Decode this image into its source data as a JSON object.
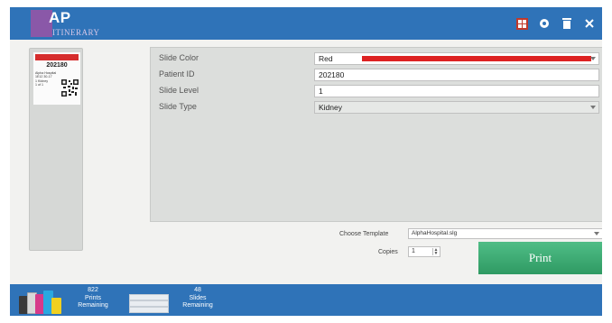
{
  "header": {
    "logo_text": "AP",
    "logo_sub": "ITINERARY",
    "icons": [
      "cassette-icon",
      "gear-icon",
      "trash-icon",
      "close-icon"
    ]
  },
  "preview": {
    "slide_id": "202180",
    "label_lines": [
      "Alpha Hospital",
      "1E12 30-17",
      "1 Kidney",
      "1 of 1"
    ]
  },
  "form": {
    "fields": [
      {
        "label": "Slide Color",
        "value": "Red"
      },
      {
        "label": "Patient ID",
        "value": "202180"
      },
      {
        "label": "Slide Level",
        "value": "1"
      },
      {
        "label": "Slide Type",
        "value": "Kidney"
      }
    ],
    "color_swatch": "#dd2222"
  },
  "controls": {
    "template_label": "Choose Template",
    "template_value": "AlphaHospital.slg",
    "copies_label": "Copies",
    "copies_value": "1",
    "print_label": "Print"
  },
  "footer": {
    "prints_count": "822",
    "prints_label1": "Prints",
    "prints_label2": "Remaining",
    "slides_count": "48",
    "slides_label1": "Slides",
    "slides_label2": "Remaining"
  },
  "colors": {
    "brand_blue": "#2f73b8",
    "print_green": "#3aa872",
    "logo_purple": "#8a58a8"
  }
}
